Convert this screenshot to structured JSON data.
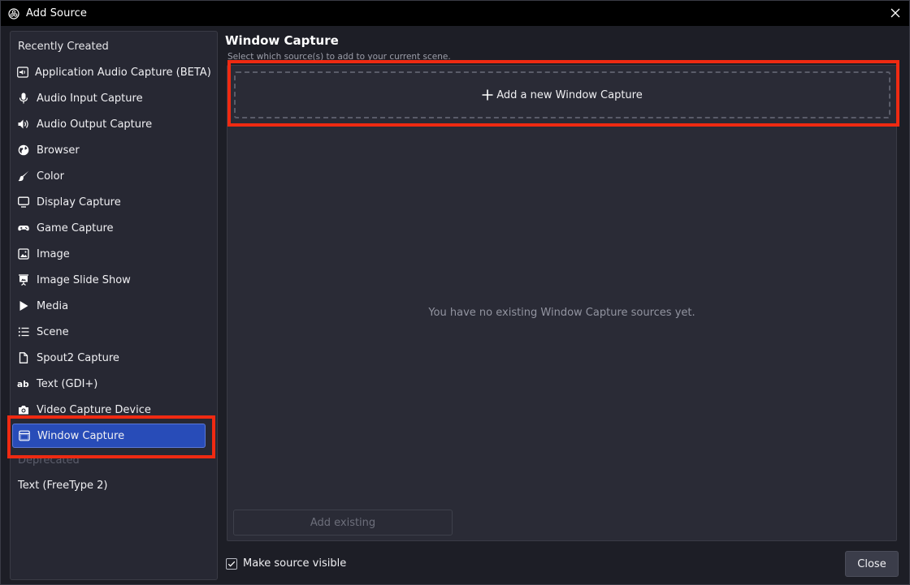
{
  "window": {
    "title": "Add Source"
  },
  "sidebar": {
    "recent_header": "Recently Created",
    "items": [
      {
        "label": "Application Audio Capture (BETA)",
        "icon": "app-audio-icon"
      },
      {
        "label": "Audio Input Capture",
        "icon": "microphone-icon"
      },
      {
        "label": "Audio Output Capture",
        "icon": "speaker-icon"
      },
      {
        "label": "Browser",
        "icon": "globe-icon"
      },
      {
        "label": "Color",
        "icon": "paintbrush-icon"
      },
      {
        "label": "Display Capture",
        "icon": "monitor-icon"
      },
      {
        "label": "Game Capture",
        "icon": "gamepad-icon"
      },
      {
        "label": "Image",
        "icon": "image-icon"
      },
      {
        "label": "Image Slide Show",
        "icon": "slideshow-icon"
      },
      {
        "label": "Media",
        "icon": "play-icon"
      },
      {
        "label": "Scene",
        "icon": "list-icon"
      },
      {
        "label": "Spout2 Capture",
        "icon": "file-icon"
      },
      {
        "label": "Text (GDI+)",
        "icon": "text-ab-icon"
      },
      {
        "label": "Video Capture Device",
        "icon": "camera-icon"
      },
      {
        "label": "Window Capture",
        "icon": "window-icon"
      }
    ],
    "selected": "Window Capture",
    "deprecated_header": "Deprecated",
    "deprecated_items": [
      {
        "label": "Text (FreeType 2)"
      }
    ]
  },
  "panel": {
    "title": "Window Capture",
    "subtitle": "Select which source(s) to add to your current scene.",
    "add_new_label": "Add a new Window Capture",
    "empty_message": "You have no existing Window Capture sources yet.",
    "add_existing_label": "Add existing"
  },
  "footer": {
    "make_visible_label": "Make source visible",
    "make_visible_checked": true,
    "close_label": "Close"
  },
  "colors": {
    "selection": "#284cb8",
    "highlight_box": "#ef2a12",
    "background": "#1d1e26"
  }
}
